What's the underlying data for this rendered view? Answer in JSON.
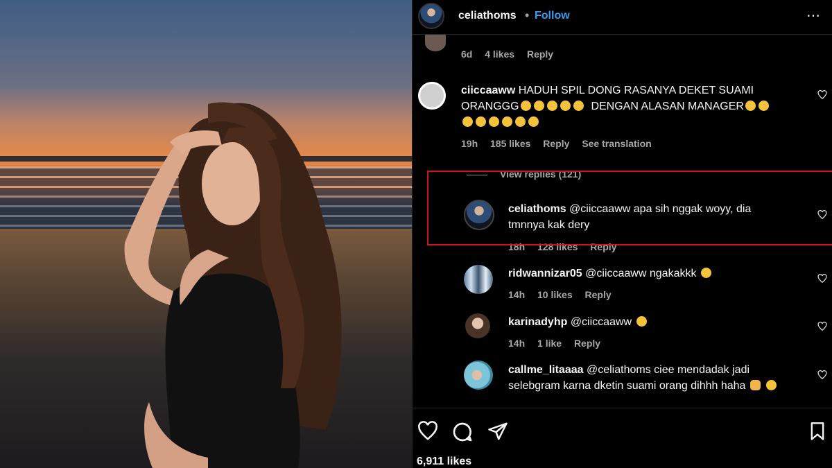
{
  "post": {
    "username": "celiathoms",
    "separator": "•",
    "follow_label": "Follow",
    "more_label": "⋯",
    "likes_total": "6,911 likes"
  },
  "prev_comment": {
    "time": "6d",
    "likes": "4 likes",
    "reply": "Reply"
  },
  "comments": [
    {
      "username": "ciiccaaww",
      "text_line1": "HADUH SPIL DONG RASANYA DEKET SUAMI",
      "text_line2a": "ORANGGG",
      "text_line2b": "DENGAN ALASAN MANAGER",
      "time": "19h",
      "likes": "185 likes",
      "reply": "Reply",
      "translate": "See translation"
    }
  ],
  "view_replies": "View replies (121)",
  "replies": [
    {
      "username": "celiathoms",
      "mention": "@ciiccaaww",
      "text_line1": "apa sih nggak woyy, dia",
      "text_line2": "tmnnya kak dery",
      "time": "18h",
      "likes": "128 likes",
      "reply": "Reply"
    },
    {
      "username": "ridwannizar05",
      "mention": "@ciiccaaww",
      "text_line1": "ngakakkk",
      "time": "14h",
      "likes": "10 likes",
      "reply": "Reply"
    },
    {
      "username": "karinadyhp",
      "mention": "@ciiccaaww",
      "text_line1": "",
      "time": "14h",
      "likes": "1 like",
      "reply": "Reply"
    },
    {
      "username": "callme_litaaaa",
      "mention": "@celiathoms",
      "text_line1": "ciee mendadak jadi",
      "text_line2": "selebgram karna dketin suami orang dihhh haha"
    }
  ],
  "icons": {
    "heart": "heart-icon",
    "comment": "comment-icon",
    "share": "share-icon",
    "save": "bookmark-icon"
  },
  "colors": {
    "follow": "#3c9bf0",
    "highlight_box": "#d0141b",
    "muted": "#a8a8a8"
  }
}
